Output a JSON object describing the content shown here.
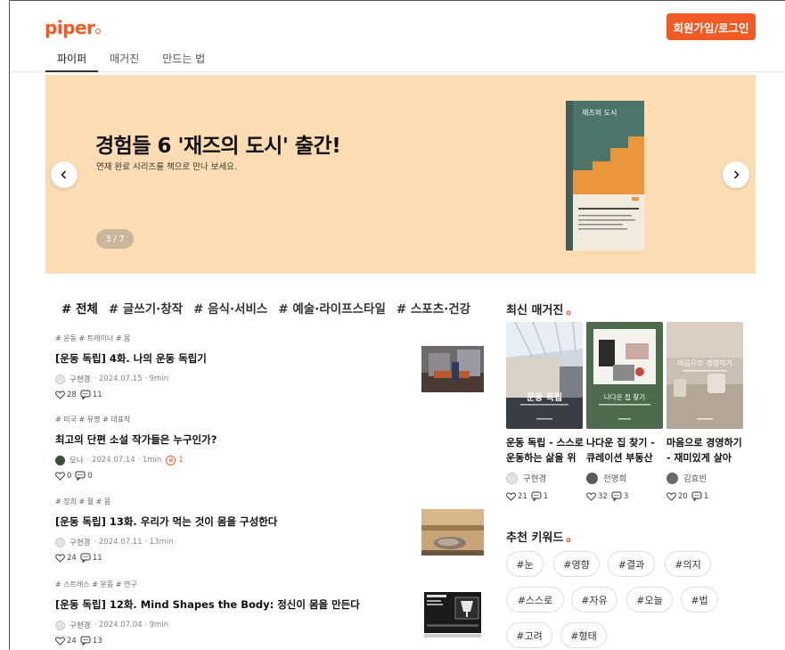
{
  "header": {
    "logo": "piper",
    "login_label": "회원가입/로그인",
    "nav_tabs": [
      "파이퍼",
      "매거진",
      "만드는 법"
    ]
  },
  "banner": {
    "title": "경험들 6 '재즈의 도시' 출간!",
    "subtitle": "연재 완료 시리즈를 책으로 만나 보세요.",
    "pager": "3 / 7",
    "book_title": "재즈의 도시",
    "background": "#fcddb3"
  },
  "keyword_tabs": [
    "# 전체",
    "# 글쓰기·창작",
    "# 음식·서비스",
    "# 예술·라이프스타일",
    "# 스포츠·건강"
  ],
  "posts": [
    {
      "tags": "# 운동 # 트레이너 # 몸",
      "title": "[운동 독립] 4화. 나의 운동 독립기",
      "author": "구현경",
      "meta": "· 2024.07.15 · 9min",
      "likes": "28",
      "comments": "11",
      "coins": ""
    },
    {
      "tags": "# 미국 # 유명 # 대표작",
      "title": "최고의 단편 소설 작가들은 누구인가?",
      "author": "모나",
      "meta": "· 2024.07.14 · 1min",
      "likes": "0",
      "comments": "0",
      "coins": "1"
    },
    {
      "tags": "# 장희 # 젊 # 몸",
      "title": "[운동 독립] 13화. 우리가 먹는 것이 몸을 구성한다",
      "author": "구현경",
      "meta": "· 2024.07.11 · 13min",
      "likes": "24",
      "comments": "11",
      "coins": ""
    },
    {
      "tags": "# 스트레스 # 운동 # 연구",
      "title": "[운동 독립] 12화. Mind Shapes the Body: 정신이 몸을 만든다",
      "author": "구현경",
      "meta": "· 2024.07.04 · 9min",
      "likes": "24",
      "comments": "13",
      "coins": ""
    }
  ],
  "magazines": {
    "heading": "최신 매거진",
    "items": [
      {
        "cover_text": "운동 독립",
        "title": "운동 독립 - 스스로 운동하는 삶을 위",
        "author": "구현경",
        "likes": "21",
        "comments": "1"
      },
      {
        "cover_text": "나다운 집 찾기",
        "title": "나다운 집 찾기 - 큐레이션 부동산",
        "author": "전명희",
        "likes": "32",
        "comments": "3"
      },
      {
        "cover_text": "마음으로 경영하기",
        "title": "마음으로 경영하기 - 재미있게 살아",
        "author": "김효빈",
        "likes": "20",
        "comments": "1"
      }
    ]
  },
  "recommended": {
    "heading": "추천 키워드",
    "chips": [
      "#눈",
      "#영향",
      "#결과",
      "#의지",
      "#스스로",
      "#자유",
      "#오늘",
      "#법",
      "#고려",
      "#형태"
    ]
  },
  "colors": {
    "accent": "#f15a22"
  }
}
